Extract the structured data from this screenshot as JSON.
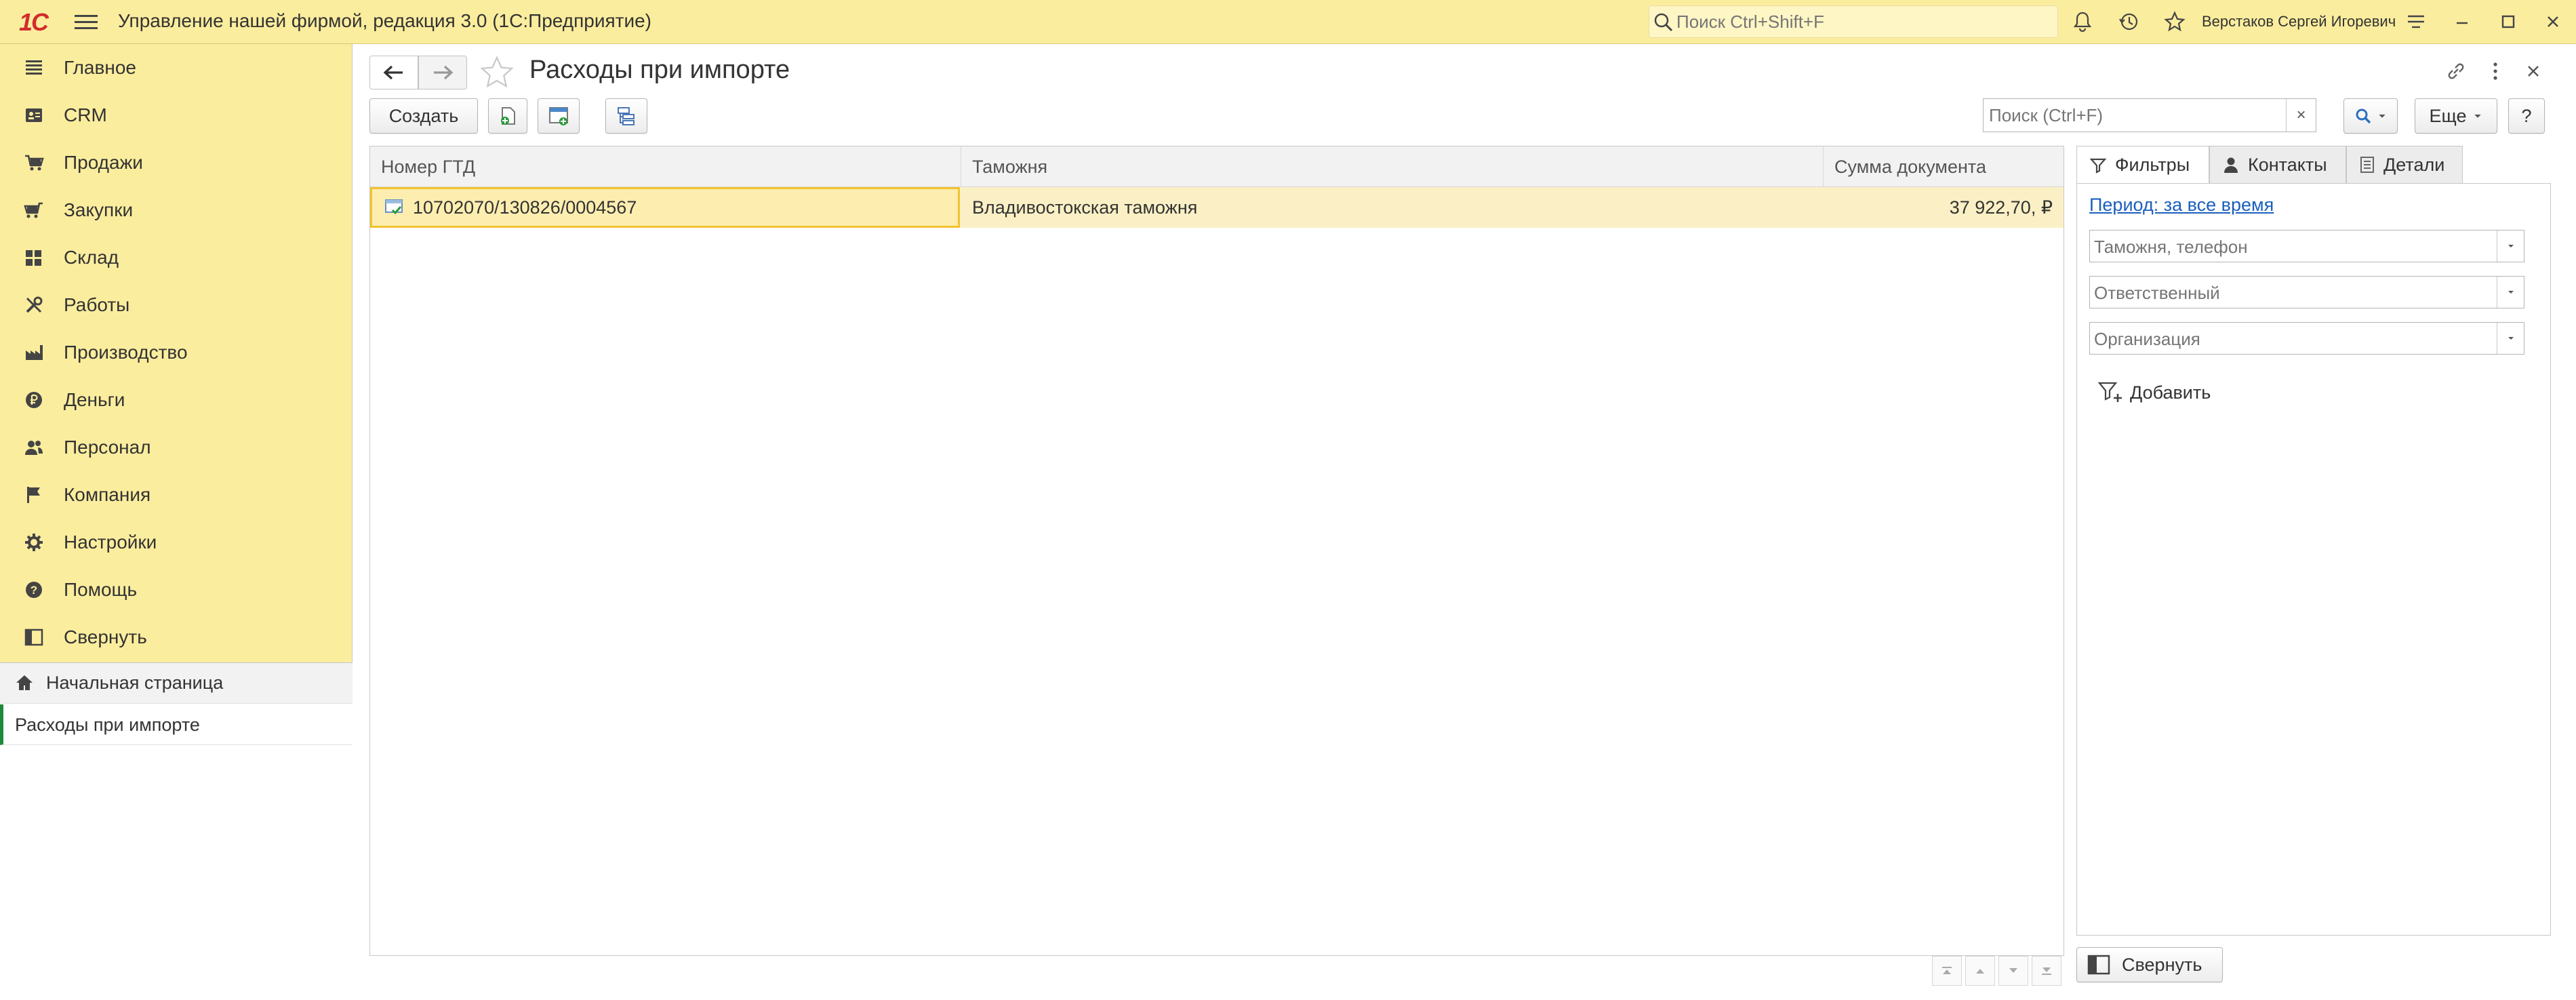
{
  "titlebar": {
    "logo": "1С",
    "app_title": "Управление нашей фирмой, редакция 3.0  (1С:Предприятие)",
    "search_placeholder": "Поиск Ctrl+Shift+F",
    "user_name": "Верстаков Сергей Игоревич"
  },
  "sidebar": {
    "items": [
      {
        "label": "Главное",
        "icon": "list-icon"
      },
      {
        "label": "CRM",
        "icon": "crm-icon"
      },
      {
        "label": "Продажи",
        "icon": "cart-icon"
      },
      {
        "label": "Закупки",
        "icon": "purchases-icon"
      },
      {
        "label": "Склад",
        "icon": "warehouse-icon"
      },
      {
        "label": "Работы",
        "icon": "tools-icon"
      },
      {
        "label": "Производство",
        "icon": "factory-icon"
      },
      {
        "label": "Деньги",
        "icon": "ruble-icon"
      },
      {
        "label": "Персонал",
        "icon": "people-icon"
      },
      {
        "label": "Компания",
        "icon": "flag-icon"
      },
      {
        "label": "Настройки",
        "icon": "gear-icon"
      },
      {
        "label": "Помощь",
        "icon": "help-icon"
      },
      {
        "label": "Свернуть",
        "icon": "collapse-panel-icon"
      }
    ],
    "home_label": "Начальная страница",
    "current_window": "Расходы при импорте"
  },
  "main": {
    "title": "Расходы при импорте",
    "create_label": "Создать",
    "search_placeholder": "Поиск (Ctrl+F)",
    "clear_label": "×",
    "more_label": "Еще",
    "help_label": "?"
  },
  "table": {
    "columns": [
      "Номер ГТД",
      "Таможня",
      "Сумма документа"
    ],
    "rows": [
      {
        "gtd": "10702070/130826/0004567",
        "customs": "Владивостокская таможня",
        "sum": "37 922,70, ₽"
      }
    ]
  },
  "right_panel": {
    "tabs": [
      {
        "label": "Фильтры",
        "icon": "filter-icon"
      },
      {
        "label": "Контакты",
        "icon": "person-icon"
      },
      {
        "label": "Детали",
        "icon": "details-icon"
      }
    ],
    "period_link": "Период: за все время",
    "filters": [
      {
        "placeholder": "Таможня, телефон"
      },
      {
        "placeholder": "Ответственный"
      },
      {
        "placeholder": "Организация"
      }
    ],
    "add_label": "Добавить",
    "collapse_label": "Свернуть"
  },
  "colors": {
    "accent_yellow": "#fbed9e",
    "selected_row": "#fbf0c5",
    "selection_border": "#f2c230",
    "link": "#1b5fbd"
  }
}
